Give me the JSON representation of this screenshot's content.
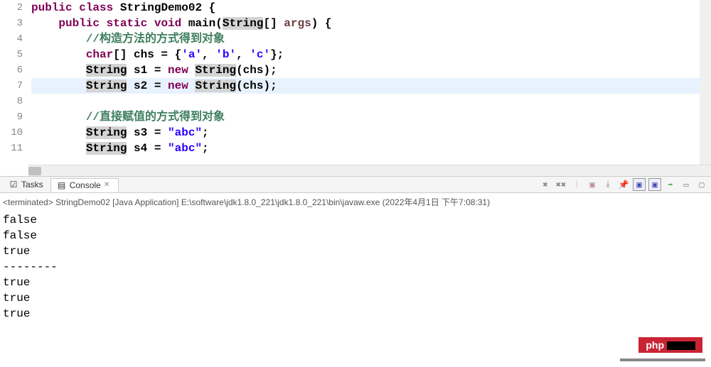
{
  "editor": {
    "lines": [
      {
        "num": "2",
        "indent": "",
        "tokens": [
          {
            "t": "kw",
            "v": "public"
          },
          {
            "t": "plain",
            "v": " "
          },
          {
            "t": "kw",
            "v": "class"
          },
          {
            "t": "plain",
            "v": " StringDemo02 {"
          }
        ]
      },
      {
        "num": "3",
        "indent": "    ",
        "fold": true,
        "tokens": [
          {
            "t": "kw",
            "v": "public"
          },
          {
            "t": "plain",
            "v": " "
          },
          {
            "t": "kw",
            "v": "static"
          },
          {
            "t": "plain",
            "v": " "
          },
          {
            "t": "kw",
            "v": "void"
          },
          {
            "t": "plain",
            "v": " main("
          },
          {
            "t": "type",
            "v": "String"
          },
          {
            "t": "plain",
            "v": "[] "
          },
          {
            "t": "param",
            "v": "args"
          },
          {
            "t": "plain",
            "v": ") {"
          }
        ]
      },
      {
        "num": "4",
        "indent": "        ",
        "tokens": [
          {
            "t": "comment",
            "v": "//构造方法的方式得到对象"
          }
        ]
      },
      {
        "num": "5",
        "indent": "        ",
        "tokens": [
          {
            "t": "kw",
            "v": "char"
          },
          {
            "t": "plain",
            "v": "[] chs = {"
          },
          {
            "t": "str",
            "v": "'a'"
          },
          {
            "t": "plain",
            "v": ", "
          },
          {
            "t": "str",
            "v": "'b'"
          },
          {
            "t": "plain",
            "v": ", "
          },
          {
            "t": "str",
            "v": "'c'"
          },
          {
            "t": "plain",
            "v": "};"
          }
        ]
      },
      {
        "num": "6",
        "indent": "        ",
        "tokens": [
          {
            "t": "type",
            "v": "String"
          },
          {
            "t": "plain",
            "v": " s1 = "
          },
          {
            "t": "kw",
            "v": "new"
          },
          {
            "t": "plain",
            "v": " "
          },
          {
            "t": "type",
            "v": "String"
          },
          {
            "t": "plain",
            "v": "(chs);"
          }
        ]
      },
      {
        "num": "7",
        "indent": "        ",
        "highlight": true,
        "tokens": [
          {
            "t": "type",
            "v": "String"
          },
          {
            "t": "plain",
            "v": " s2 = "
          },
          {
            "t": "kw",
            "v": "new"
          },
          {
            "t": "plain",
            "v": " "
          },
          {
            "t": "type",
            "v": "String"
          },
          {
            "t": "plain",
            "v": "(chs);"
          }
        ]
      },
      {
        "num": "8",
        "indent": "",
        "tokens": []
      },
      {
        "num": "9",
        "indent": "        ",
        "tokens": [
          {
            "t": "comment",
            "v": "//直接赋值的方式得到对象"
          }
        ]
      },
      {
        "num": "10",
        "indent": "        ",
        "tokens": [
          {
            "t": "type",
            "v": "String"
          },
          {
            "t": "plain",
            "v": " s3 = "
          },
          {
            "t": "str",
            "v": "\"abc\""
          },
          {
            "t": "plain",
            "v": ";"
          }
        ]
      },
      {
        "num": "11",
        "indent": "        ",
        "tokens": [
          {
            "t": "type",
            "v": "String"
          },
          {
            "t": "plain",
            "v": " s4 = "
          },
          {
            "t": "str",
            "v": "\"abc\""
          },
          {
            "t": "plain",
            "v": ";"
          }
        ]
      }
    ]
  },
  "tabs": {
    "tasks": "Tasks",
    "console": "Console"
  },
  "console": {
    "status_prefix": "<terminated>",
    "status": "StringDemo02 [Java Application] E:\\software\\jdk1.8.0_221\\jdk1.8.0_221\\bin\\javaw.exe (2022年4月1日 下午7:08:31)",
    "output": [
      "false",
      "false",
      "true",
      "--------",
      "true",
      "true",
      "true"
    ]
  },
  "watermark": "php"
}
